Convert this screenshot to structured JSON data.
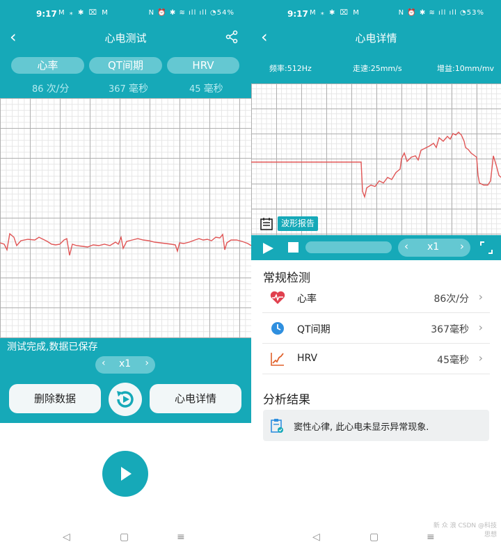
{
  "left": {
    "status": {
      "time": "9:17",
      "icons": "M ⁎ ✱ ⌧ M",
      "right": "N ⏰ ✱ ≋ ıll ıll ◔54%"
    },
    "title": "心电测试",
    "tabs": [
      "心率",
      "QT间期",
      "HRV"
    ],
    "values": [
      {
        "num": "86",
        "unit": "次/分"
      },
      {
        "num": "367",
        "unit": "毫秒"
      },
      {
        "num": "45",
        "unit": "毫秒"
      }
    ],
    "status_msg": "测试完成,数据已保存",
    "speed": {
      "prev": "‹",
      "label": "x1",
      "next": "›"
    },
    "delete_label": "删除数据",
    "detail_label": "心电详情",
    "nav": {
      "back": "◁",
      "home": "▢",
      "menu": "≡"
    }
  },
  "right": {
    "status": {
      "time": "9:17",
      "icons": "M ⁎ ✱ ⌧ M",
      "right": "N ⏰ ✱ ≋ ıll ıll ◔53%"
    },
    "title": "心电详情",
    "params": {
      "freq": "频率:512Hz",
      "speed": "走速:25mm/s",
      "gain": "增益:10mm/mv"
    },
    "report_label": "波形报告",
    "speed": {
      "prev": "‹",
      "label": "x1",
      "next": "›"
    },
    "routine_title": "常规检测",
    "items": [
      {
        "label": "心率",
        "value": "86次/分"
      },
      {
        "label": "QT间期",
        "value": "367毫秒"
      },
      {
        "label": "HRV",
        "value": "45毫秒"
      }
    ],
    "analysis_title": "分析结果",
    "analysis_text": "窦性心律, 此心电未显示异常现象.",
    "watermark": "新 众 浪 CSDN @科技思想",
    "nav": {
      "back": "◁",
      "home": "▢",
      "menu": "≡"
    }
  },
  "colors": {
    "teal": "#16a9b8",
    "pill": "#64c8d2",
    "ecg": "#e05555",
    "heart": "#e0404e",
    "clock": "#2f8fdf",
    "hrv": "#e0602a"
  }
}
